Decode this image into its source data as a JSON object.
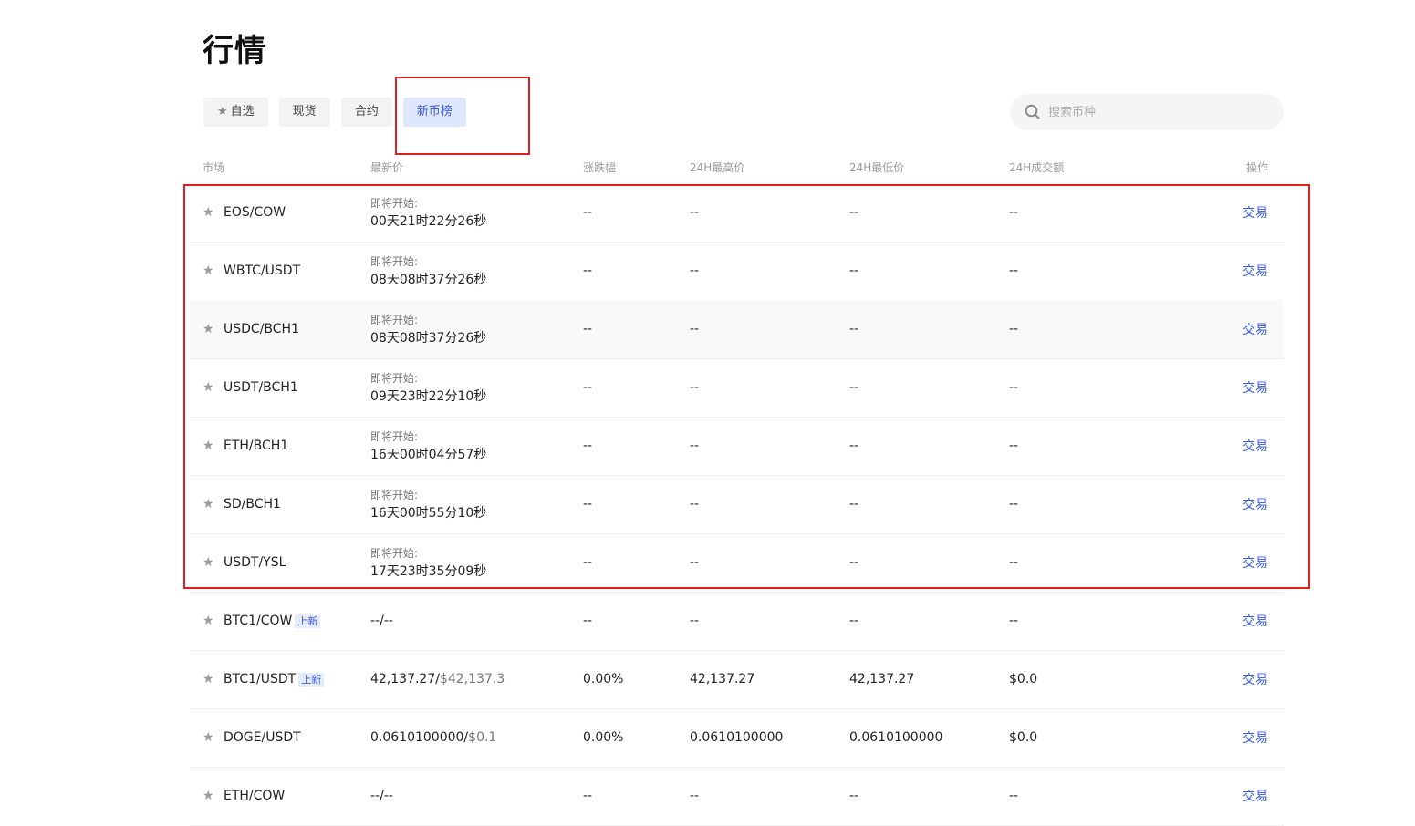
{
  "page": {
    "title": "行情"
  },
  "tabs": [
    {
      "label": "自选",
      "icon": "star-icon",
      "active": false
    },
    {
      "label": "现货",
      "active": false
    },
    {
      "label": "合约",
      "active": false
    },
    {
      "label": "新币榜",
      "active": true
    }
  ],
  "search": {
    "placeholder": "搜索币种",
    "icon": "search-icon"
  },
  "columns": {
    "market": "市场",
    "last_price": "最新价",
    "change": "涨跌幅",
    "high": "24H最高价",
    "low": "24H最低价",
    "volume": "24H成交额",
    "action": "操作"
  },
  "colors": {
    "accent": "#3b5bdb",
    "active_tab_bg": "#dfe7ff",
    "highlight_box": "#e02020"
  },
  "rows": [
    {
      "pair": "EOS/COW",
      "badge": "",
      "price_label": "即将开始:",
      "price": "00天21时22分26秒",
      "price_usd": "",
      "change": "--",
      "high": "--",
      "low": "--",
      "volume": "--",
      "action": "交易"
    },
    {
      "pair": "WBTC/USDT",
      "badge": "",
      "price_label": "即将开始:",
      "price": "08天08时37分26秒",
      "price_usd": "",
      "change": "--",
      "high": "--",
      "low": "--",
      "volume": "--",
      "action": "交易"
    },
    {
      "pair": "USDC/BCH1",
      "badge": "",
      "price_label": "即将开始:",
      "price": "08天08时37分26秒",
      "price_usd": "",
      "change": "--",
      "high": "--",
      "low": "--",
      "volume": "--",
      "action": "交易"
    },
    {
      "pair": "USDT/BCH1",
      "badge": "",
      "price_label": "即将开始:",
      "price": "09天23时22分10秒",
      "price_usd": "",
      "change": "--",
      "high": "--",
      "low": "--",
      "volume": "--",
      "action": "交易"
    },
    {
      "pair": "ETH/BCH1",
      "badge": "",
      "price_label": "即将开始:",
      "price": "16天00时04分57秒",
      "price_usd": "",
      "change": "--",
      "high": "--",
      "low": "--",
      "volume": "--",
      "action": "交易"
    },
    {
      "pair": "SD/BCH1",
      "badge": "",
      "price_label": "即将开始:",
      "price": "16天00时55分10秒",
      "price_usd": "",
      "change": "--",
      "high": "--",
      "low": "--",
      "volume": "--",
      "action": "交易"
    },
    {
      "pair": "USDT/YSL",
      "badge": "",
      "price_label": "即将开始:",
      "price": "17天23时35分09秒",
      "price_usd": "",
      "change": "--",
      "high": "--",
      "low": "--",
      "volume": "--",
      "action": "交易"
    },
    {
      "pair": "BTC1/COW",
      "badge": "上新",
      "price_label": "",
      "price": "--/--",
      "price_usd": "",
      "change": "--",
      "high": "--",
      "low": "--",
      "volume": "--",
      "action": "交易"
    },
    {
      "pair": "BTC1/USDT",
      "badge": "上新",
      "price_label": "",
      "price": "42,137.27/",
      "price_usd": "$42,137.3",
      "change": "0.00%",
      "high": "42,137.27",
      "low": "42,137.27",
      "volume": "$0.0",
      "action": "交易"
    },
    {
      "pair": "DOGE/USDT",
      "badge": "",
      "price_label": "",
      "price": "0.0610100000/",
      "price_usd": "$0.1",
      "change": "0.00%",
      "high": "0.0610100000",
      "low": "0.0610100000",
      "volume": "$0.0",
      "action": "交易"
    },
    {
      "pair": "ETH/COW",
      "badge": "",
      "price_label": "",
      "price": "--/--",
      "price_usd": "",
      "change": "--",
      "high": "--",
      "low": "--",
      "volume": "--",
      "action": "交易"
    }
  ]
}
